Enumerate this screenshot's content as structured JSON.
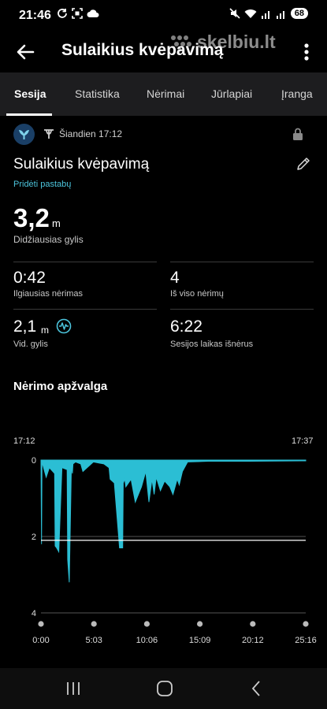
{
  "status_bar": {
    "time": "21:46",
    "battery": "68"
  },
  "watermark": {
    "text": "skelbiu.lt"
  },
  "app_bar": {
    "title": "Sulaikius kvėpavimą"
  },
  "tabs": [
    {
      "label": "Sesija",
      "active": true
    },
    {
      "label": "Statistika",
      "active": false
    },
    {
      "label": "Nėrimai",
      "active": false
    },
    {
      "label": "Jūrlapiai",
      "active": false
    },
    {
      "label": "Įranga",
      "active": false
    }
  ],
  "session": {
    "date": "Šiandien 17:12",
    "name": "Sulaikius kvėpavimą",
    "add_note": "Pridėti pastabų",
    "icons": [
      "dive-activity-icon",
      "snorkel-icon",
      "lock-icon",
      "edit-icon"
    ]
  },
  "max_depth": {
    "value": "3,2",
    "unit": "m",
    "label": "Didžiausias gylis"
  },
  "stats": {
    "longest_dive": {
      "value": "0:42",
      "label": "Ilgiausias nėrimas"
    },
    "total_dives": {
      "value": "4",
      "label": "Iš viso nėrimų"
    },
    "avg_depth": {
      "value": "2,1",
      "unit": "m",
      "label": "Vid. gylis"
    },
    "surface_time": {
      "value": "6:22",
      "label": "Sesijos laikas išnėrus"
    }
  },
  "overview": {
    "title": "Nėrimo apžvalga"
  },
  "colors": {
    "accent": "#4cc4dc",
    "chart_fill": "#2bbed4",
    "background": "#000000",
    "tabs_bg": "#1d1d1f"
  },
  "chart_data": {
    "type": "area",
    "start_time": "17:12",
    "end_time": "17:37",
    "xlabel": "",
    "ylabel": "",
    "x_ticks": [
      "0:00",
      "5:03",
      "10:06",
      "15:09",
      "20:12",
      "25:16"
    ],
    "y_ticks": [
      "0",
      "2",
      "4"
    ],
    "x_range_min": [
      0,
      25.27
    ],
    "y_range_m": [
      4,
      0
    ],
    "reference_depth_m": 2.1,
    "x": [
      0,
      0.05,
      0.1,
      0.5,
      0.8,
      1.3,
      1.35,
      1.5,
      1.7,
      2.0,
      2.5,
      2.55,
      2.7,
      2.9,
      3.0,
      3.05,
      3.3,
      3.8,
      4.0,
      5.0,
      6.0,
      6.5,
      6.6,
      7.0,
      7.5,
      7.8,
      7.85,
      8.0,
      8.1,
      8.6,
      9.0,
      9.6,
      10.0,
      10.3,
      10.6,
      10.8,
      11.0,
      11.4,
      11.8,
      12.3,
      12.6,
      13.0,
      13.2,
      13.5,
      14.0,
      16.0,
      20.0,
      25.27
    ],
    "y": [
      0,
      2.2,
      0.05,
      0.45,
      0.2,
      0.35,
      2.25,
      2.3,
      2.4,
      0.2,
      0.25,
      2.6,
      3.2,
      0.15,
      0.35,
      0.1,
      0.05,
      0.1,
      0.3,
      0.05,
      0.1,
      0.2,
      0.5,
      0.6,
      2.3,
      2.3,
      0.6,
      0.5,
      0.7,
      0.5,
      1.1,
      0.7,
      0.3,
      1.1,
      0.5,
      0.9,
      0.45,
      0.8,
      0.55,
      0.7,
      0.9,
      0.5,
      0.65,
      0.3,
      0.05,
      0.03,
      0.03,
      0.02
    ]
  }
}
